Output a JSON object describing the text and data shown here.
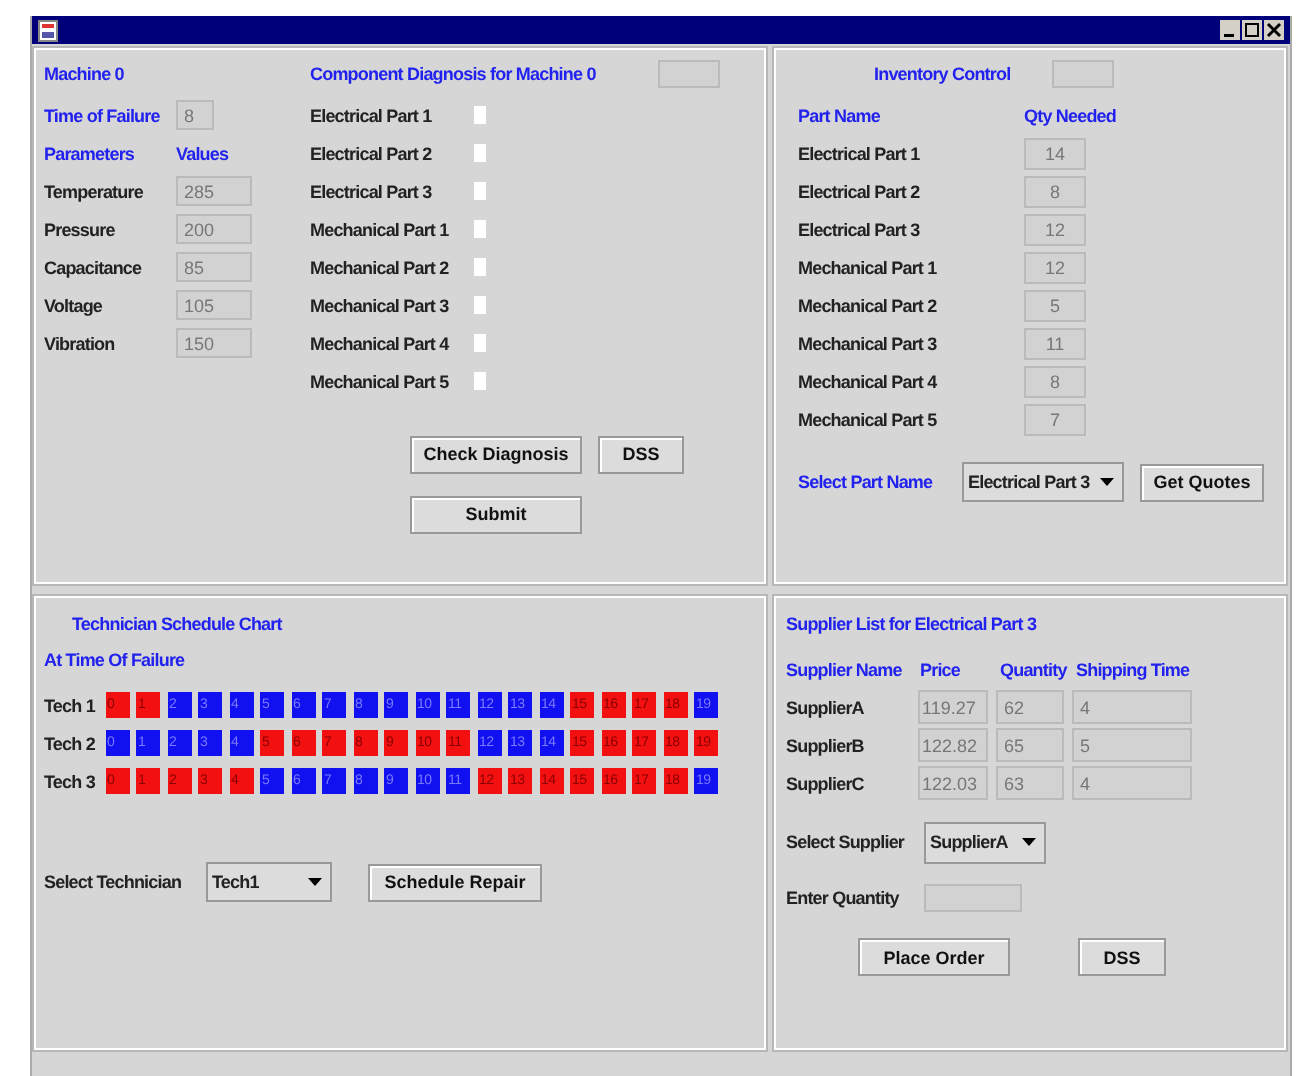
{
  "machine_panel": {
    "title": "Machine 0",
    "time_of_failure": {
      "label": "Time of Failure",
      "value": "8"
    },
    "parameters_header": "Parameters",
    "values_header": "Values",
    "parameters": [
      {
        "name": "Temperature",
        "value": "285"
      },
      {
        "name": "Pressure",
        "value": "200"
      },
      {
        "name": "Capacitance",
        "value": "85"
      },
      {
        "name": "Voltage",
        "value": "105"
      },
      {
        "name": "Vibration",
        "value": "150"
      }
    ]
  },
  "diagnosis_panel": {
    "title": "Component Diagnosis for Machine 0",
    "parts": [
      {
        "label": "Electrical Part 1",
        "checked": false
      },
      {
        "label": "Electrical Part 2",
        "checked": false
      },
      {
        "label": "Electrical Part 3",
        "checked": false
      },
      {
        "label": "Mechanical Part 1",
        "checked": false
      },
      {
        "label": "Mechanical Part 2",
        "checked": false
      },
      {
        "label": "Mechanical Part 3",
        "checked": false
      },
      {
        "label": "Mechanical Part 4",
        "checked": false
      },
      {
        "label": "Mechanical Part 5",
        "checked": false
      }
    ],
    "buttons": [
      "Check Diagnosis",
      "DSS",
      "Submit"
    ]
  },
  "inventory_panel": {
    "title": "Inventory Control",
    "columns": [
      "Part Name",
      "Qty Needed"
    ],
    "rows": [
      {
        "part": "Electrical Part 1",
        "qty": "14"
      },
      {
        "part": "Electrical Part 2",
        "qty": "8"
      },
      {
        "part": "Electrical Part 3",
        "qty": "12"
      },
      {
        "part": "Mechanical Part 1",
        "qty": "12"
      },
      {
        "part": "Mechanical Part 2",
        "qty": "5"
      },
      {
        "part": "Mechanical Part 3",
        "qty": "11"
      },
      {
        "part": "Mechanical Part 4",
        "qty": "8"
      },
      {
        "part": "Mechanical Part 5",
        "qty": "7"
      }
    ],
    "select_label": "Select Part Name",
    "selected_part": "Electrical Part 3",
    "button": "Get Quotes"
  },
  "schedule_panel": {
    "title": "Technician Schedule Chart",
    "subtitle": "At Time Of Failure",
    "technicians": [
      {
        "name": "Tech 1",
        "slots": [
          {
            "label": "0",
            "busy": true
          },
          {
            "label": "1",
            "busy": true
          },
          {
            "label": "2",
            "busy": false
          },
          {
            "label": "3",
            "busy": false
          },
          {
            "label": "4",
            "busy": false
          },
          {
            "label": "5",
            "busy": false
          },
          {
            "label": "6",
            "busy": false
          },
          {
            "label": "7",
            "busy": false
          },
          {
            "label": "8",
            "busy": false
          },
          {
            "label": "9",
            "busy": false
          },
          {
            "label": "10",
            "busy": false
          },
          {
            "label": "11",
            "busy": false
          },
          {
            "label": "12",
            "busy": false
          },
          {
            "label": "13",
            "busy": false
          },
          {
            "label": "14",
            "busy": false
          },
          {
            "label": "15",
            "busy": true
          },
          {
            "label": "16",
            "busy": true
          },
          {
            "label": "17",
            "busy": true
          },
          {
            "label": "18",
            "busy": true
          },
          {
            "label": "19",
            "busy": false
          }
        ]
      },
      {
        "name": "Tech 2",
        "slots": [
          {
            "label": "0",
            "busy": false
          },
          {
            "label": "1",
            "busy": false
          },
          {
            "label": "2",
            "busy": false
          },
          {
            "label": "3",
            "busy": false
          },
          {
            "label": "4",
            "busy": false
          },
          {
            "label": "5",
            "busy": true
          },
          {
            "label": "6",
            "busy": true
          },
          {
            "label": "7",
            "busy": true
          },
          {
            "label": "8",
            "busy": true
          },
          {
            "label": "9",
            "busy": true
          },
          {
            "label": "10",
            "busy": true
          },
          {
            "label": "11",
            "busy": true
          },
          {
            "label": "12",
            "busy": false
          },
          {
            "label": "13",
            "busy": false
          },
          {
            "label": "14",
            "busy": false
          },
          {
            "label": "15",
            "busy": true
          },
          {
            "label": "16",
            "busy": true
          },
          {
            "label": "17",
            "busy": true
          },
          {
            "label": "18",
            "busy": true
          },
          {
            "label": "19",
            "busy": true
          }
        ]
      },
      {
        "name": "Tech 3",
        "slots": [
          {
            "label": "0",
            "busy": true
          },
          {
            "label": "1",
            "busy": true
          },
          {
            "label": "2",
            "busy": true
          },
          {
            "label": "3",
            "busy": true
          },
          {
            "label": "4",
            "busy": true
          },
          {
            "label": "5",
            "busy": false
          },
          {
            "label": "6",
            "busy": false
          },
          {
            "label": "7",
            "busy": false
          },
          {
            "label": "8",
            "busy": false
          },
          {
            "label": "9",
            "busy": false
          },
          {
            "label": "10",
            "busy": false
          },
          {
            "label": "11",
            "busy": false
          },
          {
            "label": "12",
            "busy": true
          },
          {
            "label": "13",
            "busy": true
          },
          {
            "label": "14",
            "busy": true
          },
          {
            "label": "15",
            "busy": true
          },
          {
            "label": "16",
            "busy": true
          },
          {
            "label": "17",
            "busy": true
          },
          {
            "label": "18",
            "busy": true
          },
          {
            "label": "19",
            "busy": false
          }
        ]
      }
    ],
    "select_label": "Select Technician",
    "selected_technician": "Tech1",
    "button": "Schedule Repair"
  },
  "supplier_panel": {
    "title": "Supplier List for Electrical Part 3",
    "columns": [
      "Supplier Name",
      "Price",
      "Quantity",
      "Shipping Time"
    ],
    "rows": [
      {
        "name": "SupplierA",
        "price": "119.27",
        "quantity": "62",
        "shipping_time": "4"
      },
      {
        "name": "SupplierB",
        "price": "122.82",
        "quantity": "65",
        "shipping_time": "5"
      },
      {
        "name": "SupplierC",
        "price": "122.03",
        "quantity": "63",
        "shipping_time": "4"
      }
    ],
    "select_label": "Select Supplier",
    "selected_supplier": "SupplierA",
    "quantity_label": "Enter Quantity",
    "buttons": [
      "Place Order",
      "DSS"
    ]
  }
}
